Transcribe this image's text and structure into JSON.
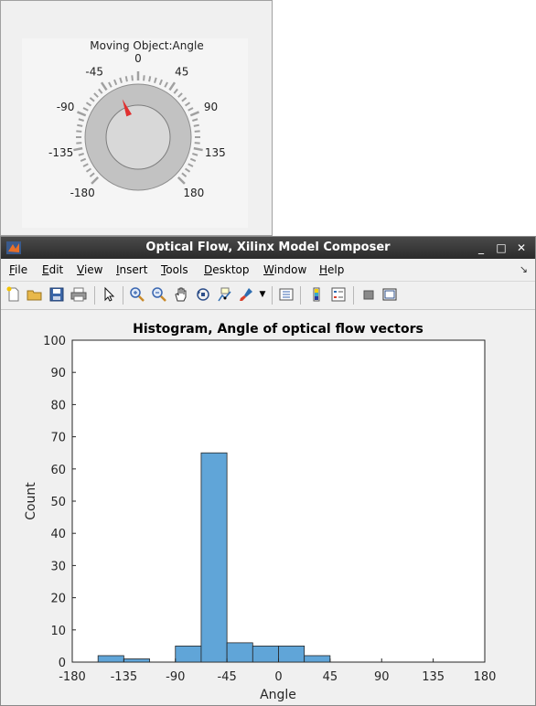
{
  "knob": {
    "title": "Moving Object:Angle",
    "value": -30,
    "scale_labels": [
      "-180",
      "-135",
      "-90",
      "-45",
      "0",
      "45",
      "90",
      "135",
      "180"
    ],
    "pointer_color": "#e03030"
  },
  "window": {
    "title": "Optical Flow, Xilinx Model Composer",
    "minimize": "_",
    "maximize": "□",
    "close": "✕"
  },
  "menu": {
    "items": [
      "File",
      "Edit",
      "View",
      "Insert",
      "Tools",
      "Desktop",
      "Window",
      "Help"
    ],
    "underline": [
      "F",
      "E",
      "V",
      "I",
      "T",
      "D",
      "W",
      "H"
    ],
    "rest": [
      "ile",
      "dit",
      "iew",
      "nsert",
      "ools",
      "esktop",
      "indow",
      "elp"
    ]
  },
  "toolbar": {
    "icons": [
      "new-figure-icon",
      "open-file-icon",
      "save-icon",
      "print-icon",
      "edit-plot-icon",
      "zoom-in-icon",
      "zoom-out-icon",
      "pan-icon",
      "rotate-3d-icon",
      "data-cursor-icon",
      "brush-icon",
      "brush-dropdown-icon",
      "link-plot-icon",
      "insert-colorbar-icon",
      "insert-legend-icon",
      "hide-plot-tools-icon",
      "show-plot-tools-icon"
    ]
  },
  "chart_data": {
    "type": "bar",
    "title": "Histogram, Angle of optical flow vectors",
    "xlabel": "Angle",
    "ylabel": "Count",
    "xlim": [
      -180,
      180
    ],
    "ylim": [
      0,
      100
    ],
    "xticks": [
      -180,
      -135,
      -90,
      -45,
      0,
      45,
      90,
      135,
      180
    ],
    "yticks": [
      0,
      10,
      20,
      30,
      40,
      50,
      60,
      70,
      80,
      90,
      100
    ],
    "bin_edges": [
      -180,
      -157.5,
      -135,
      -112.5,
      -90,
      -67.5,
      -45,
      -22.5,
      0,
      22.5,
      45,
      67.5,
      90,
      112.5,
      135,
      157.5,
      180
    ],
    "counts": [
      0,
      2,
      1,
      0,
      5,
      65,
      6,
      5,
      5,
      2,
      0,
      0,
      0,
      0,
      0,
      0
    ],
    "bar_color": "#60a5d8",
    "grid": false
  }
}
